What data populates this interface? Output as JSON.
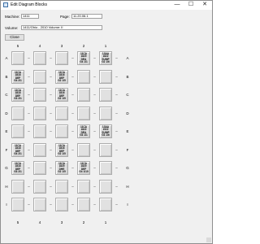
{
  "window": {
    "title": "Edit Diagram Blocks",
    "minimize_glyph": "—",
    "maximize_glyph": "☐",
    "close_glyph": "✕"
  },
  "form": {
    "machine_label": "Machine:",
    "machine_value": "1411",
    "page_label": "Page:",
    "page_value": "11.20.06.1",
    "volume_label": "Volume:",
    "volume_value": "1411/Ohio - 2010 Volume: II",
    "close_label": "Close"
  },
  "grid": {
    "column_labels": [
      "5",
      "4",
      "3",
      "2",
      "1"
    ],
    "row_labels": [
      "A",
      "B",
      "C",
      "D",
      "E",
      "F",
      "G",
      "H",
      "I"
    ],
    "dash": "–",
    "cells": [
      [
        "",
        "",
        "",
        "11CA\n1820\nDEA\nG4 1/1",
        "13AA\n1822\nSUMP\nG2 1/6"
      ],
      [
        "11CA\n1818\nDEF\nG4 2/1",
        "",
        "11CA\n1816\nDEF\nG2 1/5",
        "",
        ""
      ],
      [
        "11CA\n1818\nDEF\nG3 2/1",
        "",
        "11CA\n1816\nDEF\nG2 1/5",
        "",
        ""
      ],
      [
        "",
        "",
        "",
        "",
        ""
      ],
      [
        "",
        "",
        "",
        "11CA\n1822\nDEA\nG3 1/1",
        "13AA\n1922\nSUMP\nG3 1/6"
      ],
      [
        "11CA\n1818\nDEF\nG4 2/1",
        "",
        "11CA\n1816\nDEF\nG2 1/5",
        "",
        ""
      ],
      [
        "11CA\n1818\nDEF\nG3 2/1",
        "",
        "11CA\n1820\nDHE\nG2 1/5",
        "11CA\n1820\nDEF\nG4 1/10",
        ""
      ],
      [
        "",
        "",
        "",
        "",
        ""
      ],
      [
        "",
        "",
        "",
        "",
        ""
      ]
    ]
  }
}
